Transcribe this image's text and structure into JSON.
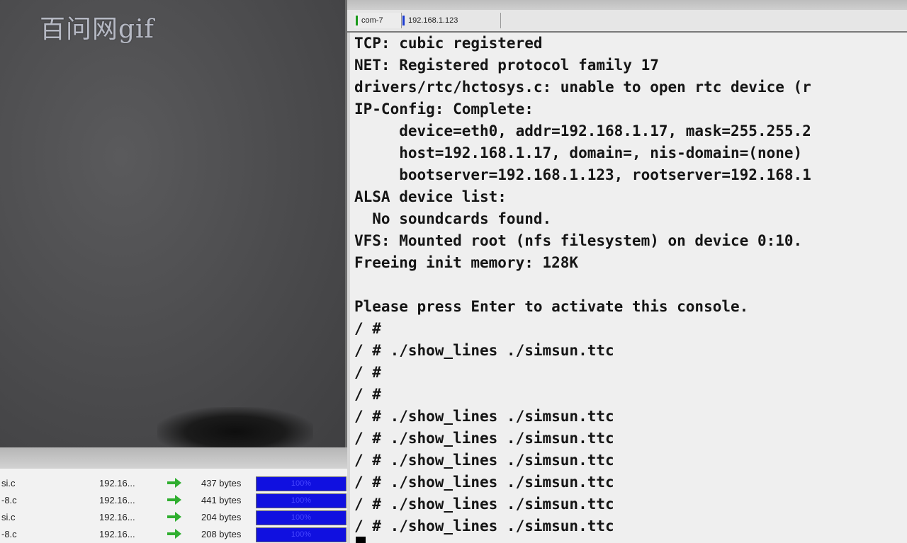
{
  "watermark": "百问网gif",
  "terminal": {
    "tabs": [
      {
        "label": "com-7",
        "color": "#1a9a1a"
      },
      {
        "label": "192.168.1.123",
        "color": "#1a3ad0"
      }
    ],
    "lines": [
      "TCP: cubic registered",
      "NET: Registered protocol family 17",
      "drivers/rtc/hctosys.c: unable to open rtc device (r",
      "IP-Config: Complete:",
      "     device=eth0, addr=192.168.1.17, mask=255.255.2",
      "     host=192.168.1.17, domain=, nis-domain=(none)",
      "     bootserver=192.168.1.123, rootserver=192.168.1",
      "ALSA device list:",
      "  No soundcards found.",
      "VFS: Mounted root (nfs filesystem) on device 0:10.",
      "Freeing init memory: 128K",
      "",
      "Please press Enter to activate this console.",
      "/ #",
      "/ # ./show_lines ./simsun.ttc",
      "/ #",
      "/ #",
      "/ # ./show_lines ./simsun.ttc",
      "/ # ./show_lines ./simsun.ttc",
      "/ # ./show_lines ./simsun.ttc",
      "/ # ./show_lines ./simsun.ttc",
      "/ # ./show_lines ./simsun.ttc",
      "/ # ./show_lines ./simsun.ttc"
    ]
  },
  "transfers": [
    {
      "file": "si.c",
      "host": "192.16...",
      "size": "437 bytes",
      "progress": "100%",
      "progress_value": 1.0
    },
    {
      "file": "-8.c",
      "host": "192.16...",
      "size": "441 bytes",
      "progress": "100%",
      "progress_value": 1.0
    },
    {
      "file": "si.c",
      "host": "192.16...",
      "size": "204 bytes",
      "progress": "100%",
      "progress_value": 1.0
    },
    {
      "file": "-8.c",
      "host": "192.16...",
      "size": "208 bytes",
      "progress": "100%",
      "progress_value": 1.0
    }
  ],
  "icons": {
    "transfer_arrow": "arrow-right-icon"
  },
  "colors": {
    "arrow": "#2fae2f",
    "progress_fill": "#1010e0"
  }
}
